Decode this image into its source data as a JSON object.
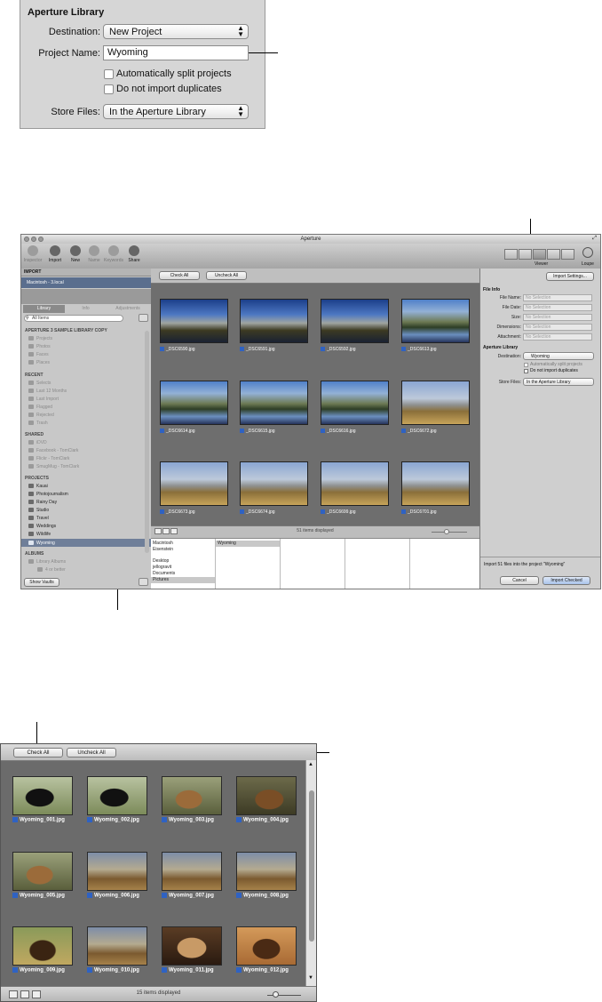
{
  "panel1": {
    "title": "Aperture Library",
    "destination_label": "Destination:",
    "destination_value": "New Project",
    "project_name_label": "Project Name:",
    "project_name_value": "Wyoming",
    "split_projects": "Automatically split projects",
    "no_duplicates": "Do not import duplicates",
    "store_files_label": "Store Files:",
    "store_files_value": "In the Aperture Library"
  },
  "window": {
    "title": "Aperture",
    "toolbar": {
      "left": [
        "Inspector",
        "Import",
        "New",
        "Name",
        "Keywords",
        "Share"
      ],
      "viewer": "Viewer",
      "loupe": "Loupe"
    },
    "import_header": "IMPORT",
    "device": "Macintosh - 3.local",
    "tabs": [
      "Library",
      "Info",
      "Adjustments"
    ],
    "search_placeholder": "All Items",
    "library_header": "APERTURE 3 SAMPLE LIBRARY COPY",
    "library_items": [
      "Projects",
      "Photos",
      "Faces",
      "Places"
    ],
    "recent_header": "RECENT",
    "recent_items": [
      "Selects",
      "Last 12 Months",
      "Last Import",
      "Flagged",
      "Rejected",
      "Trash"
    ],
    "shared_header": "SHARED",
    "shared_items": [
      "iDVD",
      "Facebook - TomClark",
      "Flickr - TomClark",
      "SmugMug - TomClark"
    ],
    "projects_header": "PROJECTS",
    "project_items": [
      "Kauai",
      "Photojournalism",
      "Rainy Day",
      "Studio",
      "Travel",
      "Weddings",
      "Wildlife",
      "Wyoming"
    ],
    "albums_header": "ALBUMS",
    "album_items": [
      "Library Albums",
      "4 or better"
    ],
    "show_vaults": "Show Vaults",
    "check_all": "Check All",
    "uncheck_all": "Uncheck All",
    "thumbnails": [
      "_DSC6590.jpg",
      "_DSC6591.jpg",
      "_DSC6592.jpg",
      "_DSC6613.jpg",
      "_DSC6614.jpg",
      "_DSC6615.jpg",
      "_DSC6616.jpg",
      "_DSC6672.jpg",
      "_DSC6673.jpg",
      "_DSC6674.jpg",
      "_DSC6699.jpg",
      "_DSC6701.jpg"
    ],
    "items_displayed": "51 items displayed",
    "browser_col1": [
      "Macintosh",
      "Eisenstein",
      "Desktop",
      "jellogravit",
      "Documents",
      "Pictures"
    ],
    "browser_col2": [
      "Wyoming"
    ],
    "import_settings": "Import Settings...",
    "file_info_header": "File Info",
    "file_info_labels": [
      "File Name:",
      "File Date:",
      "Size:",
      "Dimensions:",
      "Attachment:"
    ],
    "no_selection": "No Selection",
    "lib_header": "Aperture Library",
    "destination_label": "Destination:",
    "destination_value": "Wyoming",
    "split_projects": "Automatically split projects",
    "no_duplicates": "Do not import duplicates",
    "store_files_label": "Store Files:",
    "store_files_value": "In the Aperture Library",
    "import_message": "Import 51 files into the project \"Wyoming\"",
    "cancel": "Cancel",
    "import_checked": "Import Checked"
  },
  "panel3": {
    "check_all": "Check All",
    "uncheck_all": "Uncheck All",
    "thumbnails": [
      "Wyoming_001.jpg",
      "Wyoming_002.jpg",
      "Wyoming_003.jpg",
      "Wyoming_004.jpg",
      "Wyoming_005.jpg",
      "Wyoming_006.jpg",
      "Wyoming_007.jpg",
      "Wyoming_008.jpg",
      "Wyoming_009.jpg",
      "Wyoming_010.jpg",
      "Wyoming_011.jpg",
      "Wyoming_012.jpg"
    ],
    "items_displayed": "15 items displayed"
  }
}
